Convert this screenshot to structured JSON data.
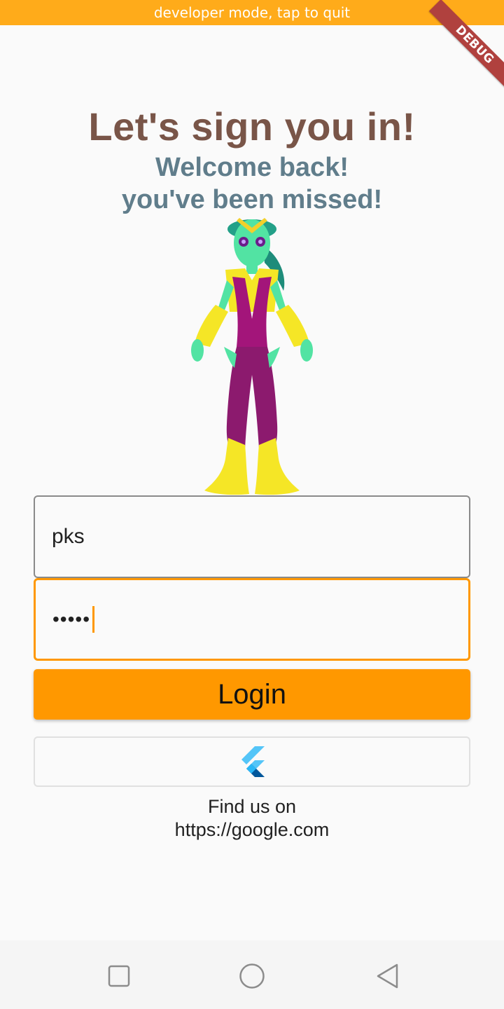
{
  "dev_banner": "developer mode, tap to quit",
  "debug_ribbon": "DEBUG",
  "heading": {
    "title": "Let's sign you in!",
    "subtitle_line1": "Welcome back!",
    "subtitle_line2": "you've been missed!"
  },
  "form": {
    "username_value": "pks",
    "password_masked": "•••••",
    "login_label": "Login",
    "flutter_button_icon": "flutter-logo-icon"
  },
  "footer": {
    "line1": "Find us on",
    "line2": "https://google.com"
  },
  "colors": {
    "accent": "#ff9800",
    "title": "#795548",
    "subtitle": "#607d8b",
    "dev_banner": "#ffab1a"
  },
  "nav": {
    "icons": [
      "recent-apps-icon",
      "home-icon",
      "back-icon"
    ]
  }
}
